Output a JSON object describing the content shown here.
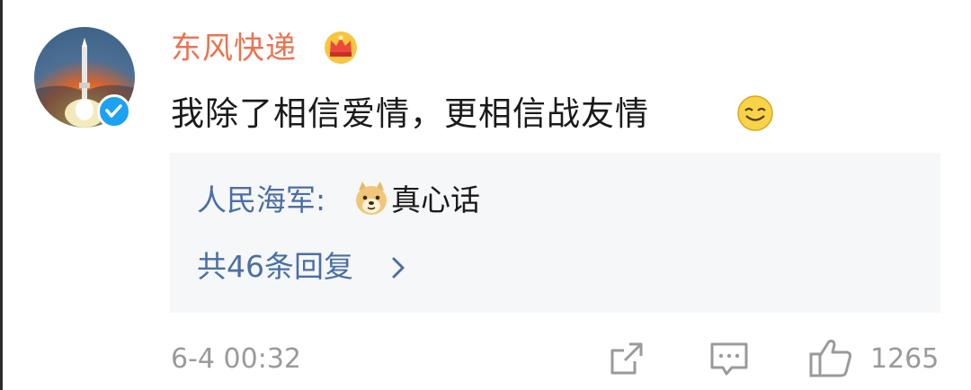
{
  "user": {
    "name": "东风快递",
    "verified": true
  },
  "comment": {
    "text": "我除了相信爱情，更相信战友情"
  },
  "reply": {
    "author": "人民海军:",
    "text": "真心话",
    "more_label": "共46条回复"
  },
  "footer": {
    "timestamp": "6-4 00:32",
    "like_count": "1265"
  },
  "colors": {
    "username": "#eb7350",
    "link": "#4a6fa5",
    "meta": "#9a9a9a",
    "reply_bg": "#f6f7f9",
    "verified": "#1da1f2"
  },
  "icons": {
    "crown": "crown-badge-icon",
    "smile": "smile-emoji-icon",
    "doge": "doge-emoji-icon",
    "chevron": "chevron-right-icon",
    "share": "share-icon",
    "comment": "comment-icon",
    "like": "thumbs-up-icon"
  }
}
